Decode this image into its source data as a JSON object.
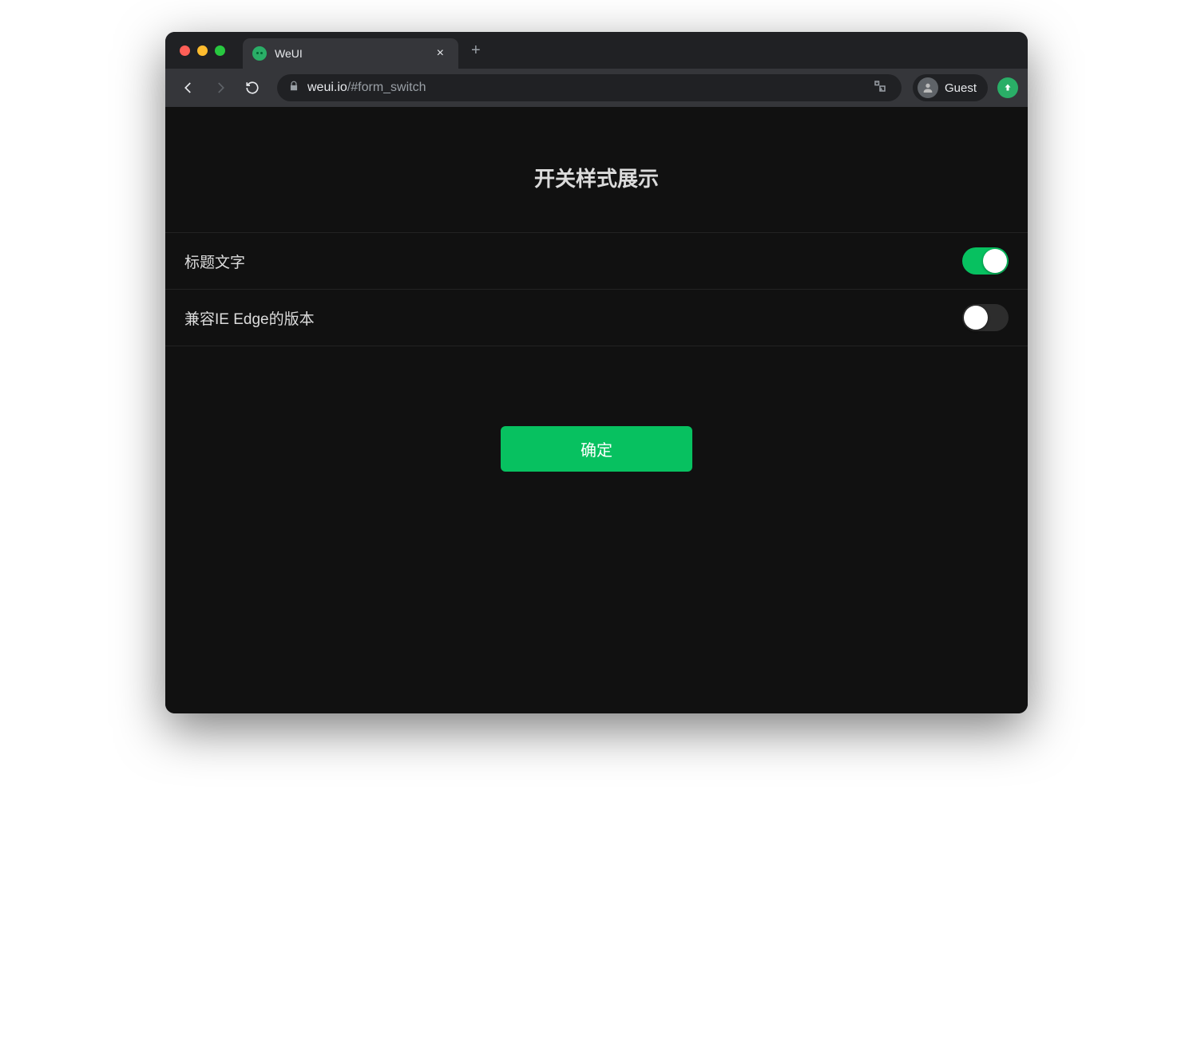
{
  "browser": {
    "tab_title": "WeUI",
    "url_host": "weui.io",
    "url_path": "/#form_switch",
    "profile_label": "Guest"
  },
  "page": {
    "title": "开关样式展示",
    "cells": [
      {
        "label": "标题文字",
        "on": true
      },
      {
        "label": "兼容IE Edge的版本",
        "on": false
      }
    ],
    "button_label": "确定"
  },
  "colors": {
    "accent": "#07c160",
    "bg": "#111111"
  }
}
